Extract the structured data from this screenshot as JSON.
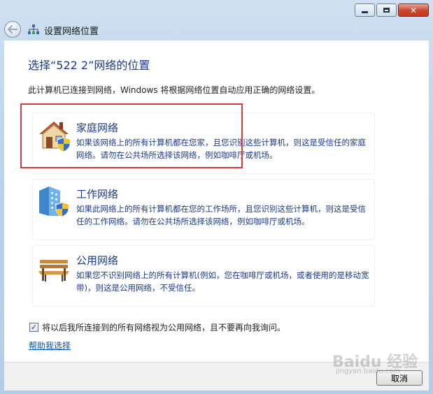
{
  "window": {
    "title": "设置网络位置",
    "controls": {
      "minimize": "minimize",
      "maximize": "maximize",
      "close": "close"
    }
  },
  "main": {
    "heading": "选择“522  2”网络的位置",
    "description": "此计算机已连接到网络，Windows 将根据网络位置自动应用正确的网络设置。",
    "options": [
      {
        "title": "家庭网络",
        "description": "如果该网络上的所有计算机都在您家，且您识别这些计算机，则这是受信任的家庭网络。请勿在公共场所选择该网络，例如咖啡厅或机场。",
        "icon": "house-shield-icon"
      },
      {
        "title": "工作网络",
        "description": "如果此网络上的所有计算机都在您的工作场所，且您识别这些计算机，则这是受信任的工作网络。请勿在公共场所选择该网络，例如咖啡厅或机场。",
        "icon": "office-building-shield-icon"
      },
      {
        "title": "公用网络",
        "description": "如果您不识别网络上的所有计算机(例如，您在咖啡厅或机场，或者使用的是移动宽带)，则这是公用网络，不受信任。",
        "icon": "park-bench-icon"
      }
    ],
    "checkbox": {
      "checked": true,
      "label": "将以后我所连接到的所有网络视为公用网络，且不要再向我询问。"
    },
    "help_link": "帮助我选择"
  },
  "footer": {
    "cancel_label": "取消"
  },
  "watermark": {
    "text": "Baidu 经验",
    "sub": "jingyan.baidu.com"
  },
  "colors": {
    "heading": "#1b3a8c",
    "link": "#0b4fc4",
    "highlight": "#d93a3a"
  }
}
